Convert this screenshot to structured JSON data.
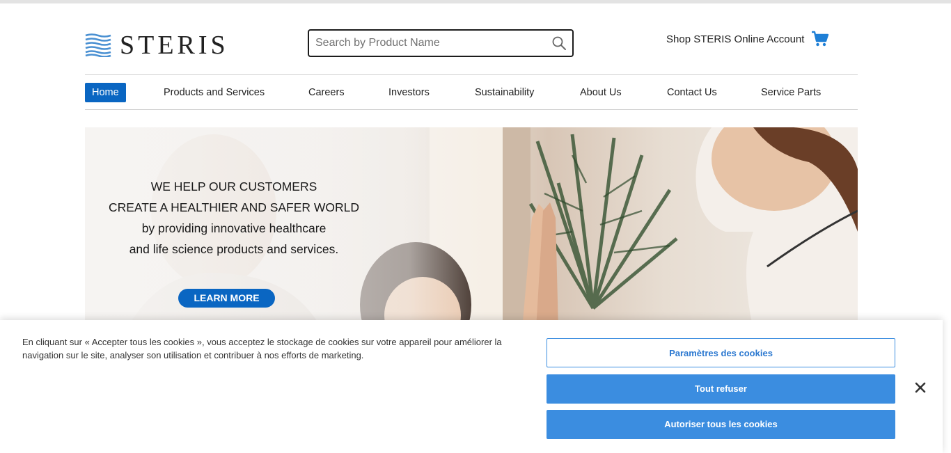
{
  "brand": {
    "name": "STERIS",
    "logo_color": "#4a90d2"
  },
  "search": {
    "placeholder": "Search by Product Name",
    "value": ""
  },
  "header": {
    "shop_label": "Shop STERIS Online Account"
  },
  "nav": {
    "items": [
      {
        "label": "Home",
        "active": true
      },
      {
        "label": "Products and Services"
      },
      {
        "label": "Careers"
      },
      {
        "label": "Investors"
      },
      {
        "label": "Sustainability"
      },
      {
        "label": "About Us"
      },
      {
        "label": "Contact Us"
      },
      {
        "label": "Service Parts"
      }
    ]
  },
  "hero": {
    "lines": [
      "WE HELP OUR CUSTOMERS",
      "CREATE A HEALTHIER AND SAFER WORLD",
      "by providing innovative healthcare",
      "and life science products and services."
    ],
    "cta_label": "LEARN MORE"
  },
  "cookie_banner": {
    "text": "En cliquant sur « Accepter tous les cookies », vous acceptez le stockage de cookies sur votre appareil pour améliorer la navigation sur le site, analyser son utilisation et contribuer à nos efforts de marketing.",
    "settings_label": "Paramètres des cookies",
    "reject_label": "Tout refuser",
    "accept_label": "Autoriser tous les cookies"
  },
  "colors": {
    "primary": "#0a66c2",
    "cookie_button": "#3b8de0"
  },
  "icons": {
    "search": "search-icon",
    "cart": "cart-icon",
    "close": "close-icon",
    "logo": "wave-logo-icon"
  }
}
